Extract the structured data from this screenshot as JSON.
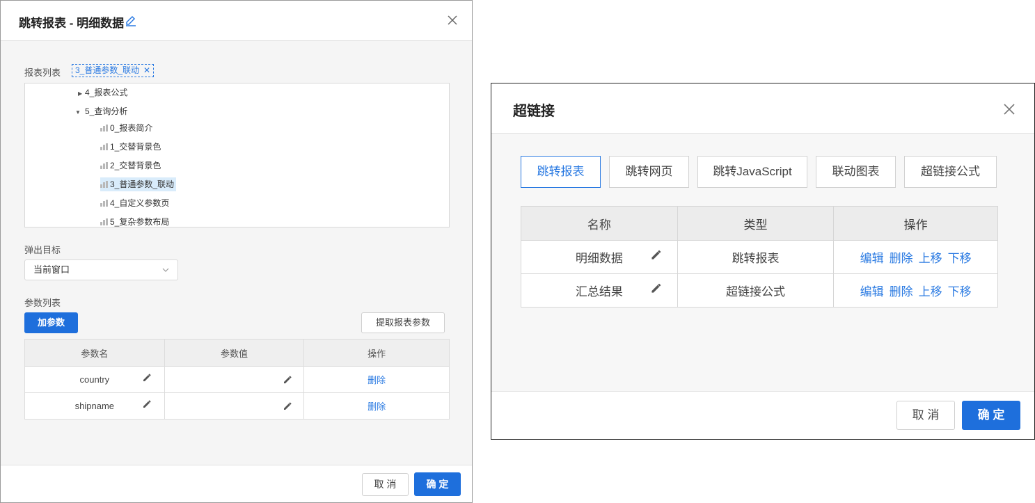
{
  "dialog_jump": {
    "title": "跳转报表 - 明细数据",
    "report_list_label": "报表列表",
    "selected_tag": "3_普通参数_联动",
    "tag_close": "✕",
    "tree": [
      {
        "label": "4_报表公式",
        "kind": "folder",
        "expanded": false
      },
      {
        "label": "5_查询分析",
        "kind": "folder",
        "expanded": true
      },
      {
        "label": "0_报表简介",
        "kind": "report"
      },
      {
        "label": "1_交替背景色",
        "kind": "report"
      },
      {
        "label": "2_交替背景色",
        "kind": "report"
      },
      {
        "label": "3_普通参数_联动",
        "kind": "report",
        "selected": true
      },
      {
        "label": "4_自定义参数页",
        "kind": "report"
      },
      {
        "label": "5_复杂参数布局",
        "kind": "report"
      }
    ],
    "popup_target_label": "弹出目标",
    "popup_target_value": "当前窗口",
    "param_list_label": "参数列表",
    "add_param_button": "加参数",
    "extract_params_button": "提取报表参数",
    "param_columns": [
      "参数名",
      "参数值",
      "操作"
    ],
    "params": [
      {
        "name": "country",
        "value": "",
        "action": "删除"
      },
      {
        "name": "shipname",
        "value": "",
        "action": "删除"
      }
    ],
    "cancel_button": "取 消",
    "ok_button": "确 定"
  },
  "dialog_hyperlink": {
    "title": "超链接",
    "tabs": [
      "跳转报表",
      "跳转网页",
      "跳转JavaScript",
      "联动图表",
      "超链接公式"
    ],
    "active_tab": 0,
    "columns": [
      "名称",
      "类型",
      "操作"
    ],
    "rows": [
      {
        "name": "明细数据",
        "type": "跳转报表",
        "actions": [
          "编辑",
          "删除",
          "上移",
          "下移"
        ]
      },
      {
        "name": "汇总结果",
        "type": "超链接公式",
        "actions": [
          "编辑",
          "删除",
          "上移",
          "下移"
        ]
      }
    ],
    "cancel_button": "取 消",
    "ok_button": "确 定"
  },
  "colors": {
    "accent": "#2a7ae2",
    "primary_button": "#1e6fdc"
  }
}
